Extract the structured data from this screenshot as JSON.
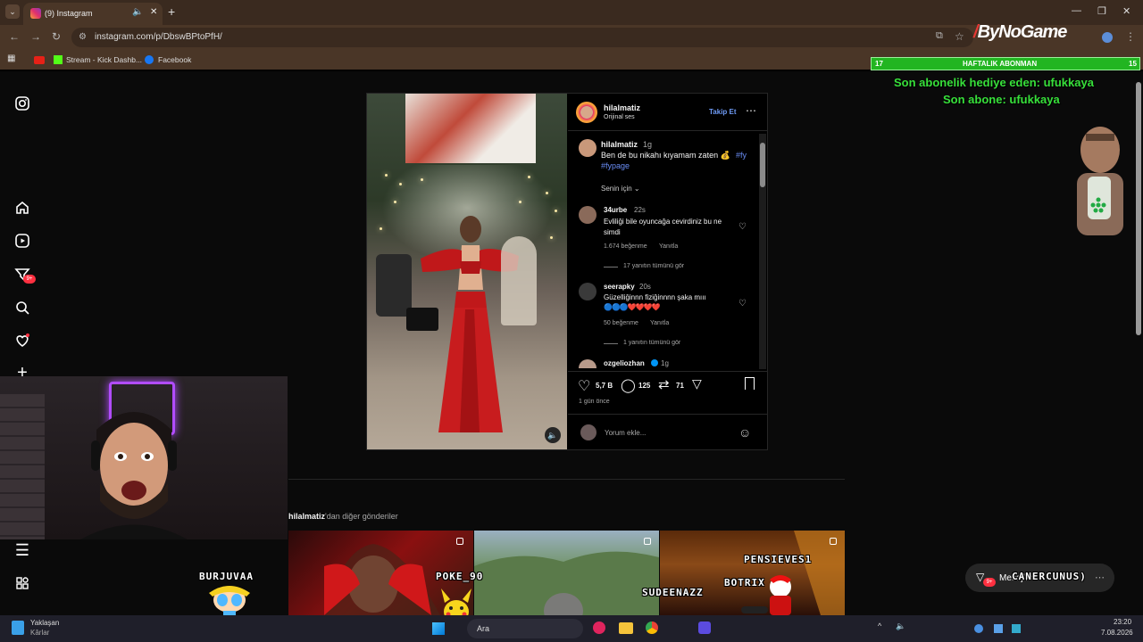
{
  "browser": {
    "tab_title": "(9) Instagram",
    "url": "instagram.com/p/DbswBPtoPfH/",
    "bookmarks": [
      "Stream - Kick Dashb...",
      "Facebook"
    ],
    "brand": "ByNoGame"
  },
  "post": {
    "username": "hilalmatiz",
    "audio": "Orijinal ses",
    "follow_label": "Takip Et",
    "caption": {
      "user": "hilalmatiz",
      "time": "1g",
      "text": "Ben de bu nikahı kıyamam zaten 💰",
      "tags": "#fy",
      "tags2": "#fypage"
    },
    "sort_label": "Senin için",
    "comments": [
      {
        "user": "34urbe",
        "time": "22s",
        "text": "Evliliği bile oyuncağa cevirdiniz bu ne simdi",
        "likes": "1.674 beğenme",
        "reply": "Yanıtla",
        "view_replies": "17 yanıtın tümünü gör"
      },
      {
        "user": "seerapky",
        "time": "20s",
        "text": "Güzelliğinnn fiziğinnnn şaka mııı",
        "emojis": "🔵🔵🔵❤️❤️❤️❤️",
        "likes": "50 beğenme",
        "reply": "Yanıtla",
        "view_replies": "1 yanıtın tümünü gör"
      },
      {
        "user": "ozgeliozhan",
        "time": "1g"
      }
    ],
    "actions": {
      "likes": "5,7 B",
      "comments": "125",
      "reposts": "71"
    },
    "age": "1 gün önce",
    "comment_placeholder": "Yorum ekle..."
  },
  "more_posts": {
    "title_user": "hilalmatiz",
    "title_rest": "'dan diğer gönderiler"
  },
  "overlay": {
    "sub_left": "17",
    "sub_title": "HAFTALIK ABONMAN",
    "sub_right": "15",
    "gift_line": "Son abonelik hediye eden: ufukkaya",
    "last_sub": "Son abone: ufukkaya",
    "viewers": [
      "BURJUVAA",
      "POKE_90",
      "SUDEENAZZ",
      "PENSIEVES1",
      "BOTRIX",
      "CANERCUNUS)"
    ]
  },
  "messages": {
    "label": "Mesajlar",
    "badge": "9+"
  },
  "nav": {
    "notif_badge": "9+"
  },
  "taskbar": {
    "weather_title": "Yaklaşan",
    "weather_sub": "Kârlar",
    "search": "Ara",
    "time": "23:20",
    "date": "7.08.2026"
  },
  "colors": {
    "accent": "#0095f6",
    "overlay_green": "#37e03a",
    "like_red": "#ff3040"
  }
}
